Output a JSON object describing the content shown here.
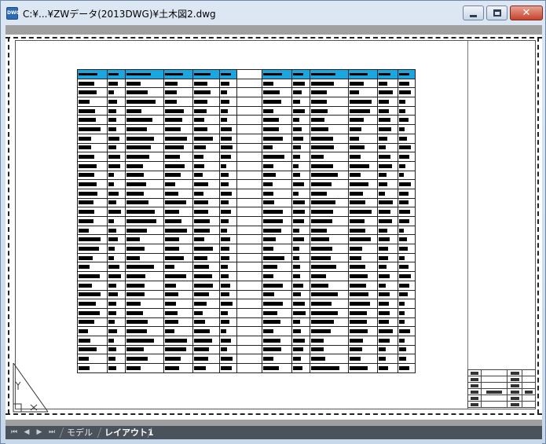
{
  "window": {
    "title": "C:¥...¥ZWデータ(2013DWG)¥土木図2.dwg",
    "icon_name": "dwg-file-icon",
    "icon_text": "DWG",
    "close_glyph": "✕"
  },
  "layout_tabs": {
    "items": [
      {
        "label": "モデル",
        "active": false
      },
      {
        "label": "レイアウト1",
        "active": true
      }
    ]
  },
  "navigation_icons": [
    "first-tab-icon",
    "previous-tab-icon",
    "next-tab-icon",
    "last-tab-icon"
  ],
  "colors": {
    "table_header_fill": "#1aa7e0",
    "canvas_background": "#a0a0a0",
    "tab_bar": "#4a525c"
  }
}
